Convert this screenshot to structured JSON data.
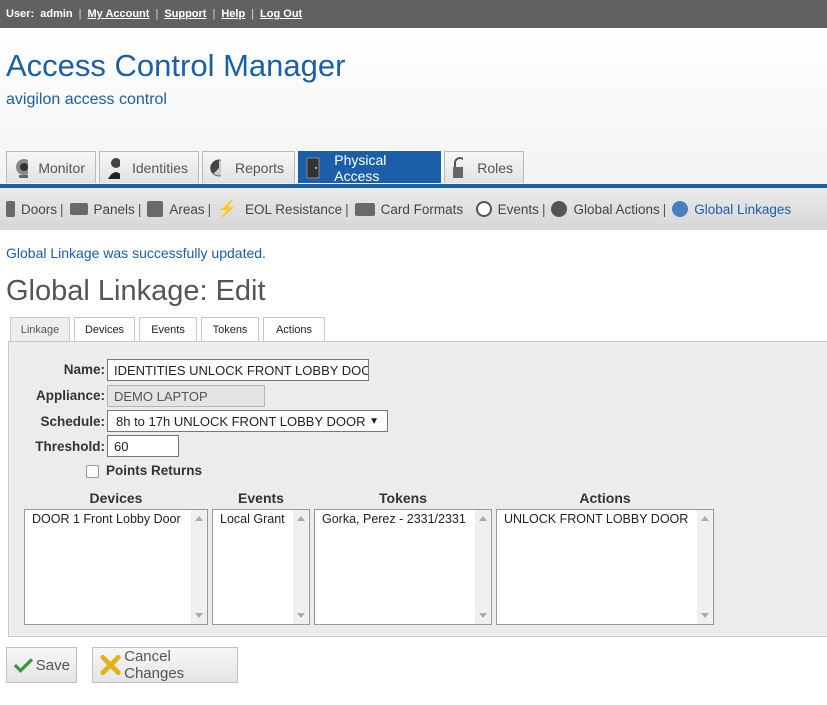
{
  "topbar": {
    "user_label": "User:",
    "user_name": "admin",
    "links": [
      "My Account",
      "Support",
      "Help",
      "Log Out"
    ]
  },
  "header": {
    "title": "Access Control Manager",
    "subtitle": "avigilon access control"
  },
  "main_tabs": [
    {
      "label": "Monitor",
      "icon": "camera-icon",
      "active": false
    },
    {
      "label": "Identities",
      "icon": "person-icon",
      "active": false
    },
    {
      "label": "Reports",
      "icon": "pie-chart-icon",
      "active": false
    },
    {
      "label": "Physical Access",
      "icon": "door-icon",
      "active": true
    },
    {
      "label": "Roles",
      "icon": "lock-icon",
      "active": false
    }
  ],
  "sub_nav": [
    {
      "label": "Doors",
      "icon": "door-icon"
    },
    {
      "label": "Panels",
      "icon": "panel-icon"
    },
    {
      "label": "Areas",
      "icon": "areas-icon"
    },
    {
      "label": "EOL Resistance",
      "icon": "lightning-icon"
    },
    {
      "label": "Card Formats",
      "icon": "card-icon"
    },
    {
      "label": "Events",
      "icon": "clock-icon"
    },
    {
      "label": "Global Actions",
      "icon": "globe-icon"
    },
    {
      "label": "Global Linkages",
      "icon": "globe-link-icon",
      "active": true
    }
  ],
  "message": "Global Linkage was successfully updated.",
  "page_title": "Global Linkage: Edit",
  "form_tabs": [
    "Linkage",
    "Devices",
    "Events",
    "Tokens",
    "Actions"
  ],
  "form": {
    "name_label": "Name:",
    "name_value": "IDENTITIES UNLOCK FRONT LOBBY DOOR",
    "appliance_label": "Appliance:",
    "appliance_value": "DEMO LAPTOP",
    "schedule_label": "Schedule:",
    "schedule_value": "8h to 17h UNLOCK FRONT LOBBY DOOR",
    "threshold_label": "Threshold:",
    "threshold_value": "60",
    "points_returns_label": "Points Returns",
    "points_returns_checked": false
  },
  "lists": {
    "devices": {
      "header": "Devices",
      "items": [
        "DOOR 1 Front Lobby Door"
      ]
    },
    "events": {
      "header": "Events",
      "items": [
        "Local Grant"
      ]
    },
    "tokens": {
      "header": "Tokens",
      "items": [
        "Gorka, Perez - 2331/2331"
      ]
    },
    "actions": {
      "header": "Actions",
      "items": [
        "UNLOCK FRONT LOBBY DOOR"
      ]
    }
  },
  "buttons": {
    "save": "Save",
    "cancel": "Cancel Changes"
  },
  "colors": {
    "accent": "#1a5fa8",
    "topbar": "#5f6163"
  }
}
